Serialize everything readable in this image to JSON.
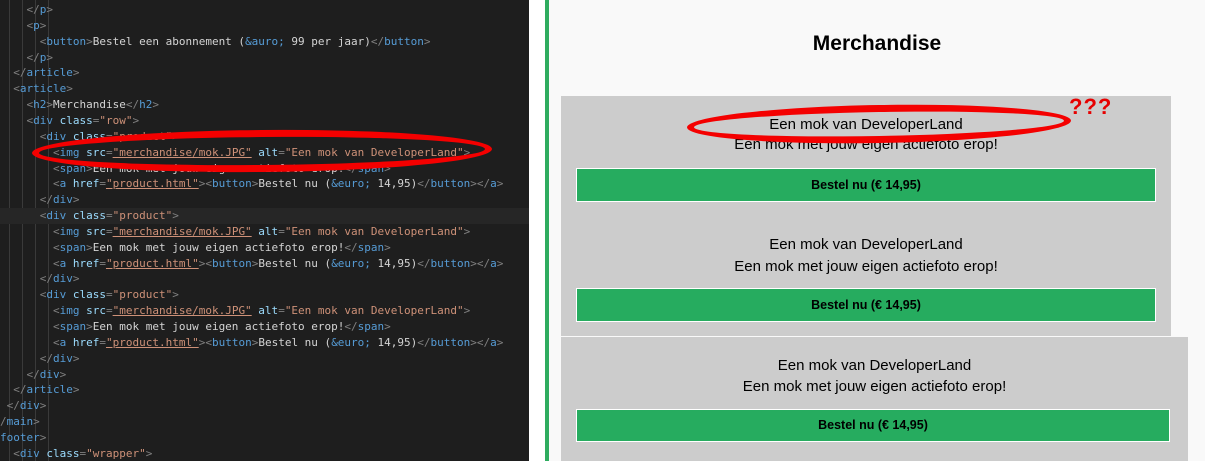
{
  "editor": {
    "lines": [
      [
        {
          "c": "t-punct",
          "t": "    </"
        },
        {
          "c": "t-tag",
          "t": "p"
        },
        {
          "c": "t-punct",
          "t": ">"
        }
      ],
      [
        {
          "c": "t-punct",
          "t": "    <"
        },
        {
          "c": "t-tag",
          "t": "p"
        },
        {
          "c": "t-punct",
          "t": ">"
        }
      ],
      [
        {
          "c": "t-punct",
          "t": "      <"
        },
        {
          "c": "t-tag",
          "t": "button"
        },
        {
          "c": "t-punct",
          "t": ">"
        },
        {
          "c": "t-text",
          "t": "Bestel een abonnement ("
        },
        {
          "c": "t-ent",
          "t": "&auro;"
        },
        {
          "c": "t-text",
          "t": " 99 per jaar)"
        },
        {
          "c": "t-punct",
          "t": "</"
        },
        {
          "c": "t-tag",
          "t": "button"
        },
        {
          "c": "t-punct",
          "t": ">"
        }
      ],
      [
        {
          "c": "t-punct",
          "t": "    </"
        },
        {
          "c": "t-tag",
          "t": "p"
        },
        {
          "c": "t-punct",
          "t": ">"
        }
      ],
      [
        {
          "c": "t-punct",
          "t": "  </"
        },
        {
          "c": "t-tag",
          "t": "article"
        },
        {
          "c": "t-punct",
          "t": ">"
        }
      ],
      [
        {
          "c": "t-punct",
          "t": "  <"
        },
        {
          "c": "t-tag",
          "t": "article"
        },
        {
          "c": "t-punct",
          "t": ">"
        }
      ],
      [
        {
          "c": "t-punct",
          "t": "    <"
        },
        {
          "c": "t-tag",
          "t": "h2"
        },
        {
          "c": "t-punct",
          "t": ">"
        },
        {
          "c": "t-text",
          "t": "Merchandise"
        },
        {
          "c": "t-punct",
          "t": "</"
        },
        {
          "c": "t-tag",
          "t": "h2"
        },
        {
          "c": "t-punct",
          "t": ">"
        }
      ],
      [
        {
          "c": "t-punct",
          "t": "    <"
        },
        {
          "c": "t-tag",
          "t": "div"
        },
        {
          "c": "t-attr",
          "t": " class"
        },
        {
          "c": "t-punct",
          "t": "="
        },
        {
          "c": "t-str",
          "t": "\"row\""
        },
        {
          "c": "t-punct",
          "t": ">"
        }
      ],
      [
        {
          "c": "t-punct",
          "t": "      <"
        },
        {
          "c": "t-tag",
          "t": "div"
        },
        {
          "c": "t-attr",
          "t": " class"
        },
        {
          "c": "t-punct",
          "t": "="
        },
        {
          "c": "t-str",
          "t": "\"product\""
        },
        {
          "c": "t-punct",
          "t": ">"
        }
      ],
      [
        {
          "c": "t-punct",
          "t": "        <"
        },
        {
          "c": "t-tag",
          "t": "img"
        },
        {
          "c": "t-attr",
          "t": " src"
        },
        {
          "c": "t-punct",
          "t": "="
        },
        {
          "c": "t-str u",
          "t": "\"merchandise/mok.JPG\""
        },
        {
          "c": "t-attr",
          "t": " alt"
        },
        {
          "c": "t-punct",
          "t": "="
        },
        {
          "c": "t-str",
          "t": "\"Een mok van DeveloperLand\""
        },
        {
          "c": "t-punct",
          "t": ">"
        }
      ],
      [
        {
          "c": "t-punct",
          "t": "        <"
        },
        {
          "c": "t-tag",
          "t": "span"
        },
        {
          "c": "t-punct",
          "t": ">"
        },
        {
          "c": "t-text",
          "t": "Een mok met jouw eigen actiefoto erop!"
        },
        {
          "c": "t-punct",
          "t": "</"
        },
        {
          "c": "t-tag",
          "t": "span"
        },
        {
          "c": "t-punct",
          "t": ">"
        }
      ],
      [
        {
          "c": "t-punct",
          "t": "        <"
        },
        {
          "c": "t-tag",
          "t": "a"
        },
        {
          "c": "t-attr",
          "t": " href"
        },
        {
          "c": "t-punct",
          "t": "="
        },
        {
          "c": "t-str u",
          "t": "\"product.html\""
        },
        {
          "c": "t-punct",
          "t": "><"
        },
        {
          "c": "t-tag",
          "t": "button"
        },
        {
          "c": "t-punct",
          "t": ">"
        },
        {
          "c": "t-text",
          "t": "Bestel nu ("
        },
        {
          "c": "t-ent",
          "t": "&euro;"
        },
        {
          "c": "t-text",
          "t": " 14,95)"
        },
        {
          "c": "t-punct",
          "t": "</"
        },
        {
          "c": "t-tag",
          "t": "button"
        },
        {
          "c": "t-punct",
          "t": "></"
        },
        {
          "c": "t-tag",
          "t": "a"
        },
        {
          "c": "t-punct",
          "t": ">"
        }
      ],
      [
        {
          "c": "t-punct",
          "t": "      </"
        },
        {
          "c": "t-tag",
          "t": "div"
        },
        {
          "c": "t-punct",
          "t": ">"
        }
      ],
      [
        {
          "c": "t-punct",
          "t": "      <"
        },
        {
          "c": "t-tag",
          "t": "div"
        },
        {
          "c": "t-attr",
          "t": " class"
        },
        {
          "c": "t-punct",
          "t": "="
        },
        {
          "c": "t-str",
          "t": "\"product\""
        },
        {
          "c": "t-punct",
          "t": ">"
        }
      ],
      [
        {
          "c": "t-punct",
          "t": "        <"
        },
        {
          "c": "t-tag",
          "t": "img"
        },
        {
          "c": "t-attr",
          "t": " src"
        },
        {
          "c": "t-punct",
          "t": "="
        },
        {
          "c": "t-str u",
          "t": "\"merchandise/mok.JPG\""
        },
        {
          "c": "t-attr",
          "t": " alt"
        },
        {
          "c": "t-punct",
          "t": "="
        },
        {
          "c": "t-str",
          "t": "\"Een mok van DeveloperLand\""
        },
        {
          "c": "t-punct",
          "t": ">"
        }
      ],
      [
        {
          "c": "t-punct",
          "t": "        <"
        },
        {
          "c": "t-tag",
          "t": "span"
        },
        {
          "c": "t-punct",
          "t": ">"
        },
        {
          "c": "t-text",
          "t": "Een mok met jouw eigen actiefoto erop!"
        },
        {
          "c": "t-punct",
          "t": "</"
        },
        {
          "c": "t-tag",
          "t": "span"
        },
        {
          "c": "t-punct",
          "t": ">"
        }
      ],
      [
        {
          "c": "t-punct",
          "t": "        <"
        },
        {
          "c": "t-tag",
          "t": "a"
        },
        {
          "c": "t-attr",
          "t": " href"
        },
        {
          "c": "t-punct",
          "t": "="
        },
        {
          "c": "t-str u",
          "t": "\"product.html\""
        },
        {
          "c": "t-punct",
          "t": "><"
        },
        {
          "c": "t-tag",
          "t": "button"
        },
        {
          "c": "t-punct",
          "t": ">"
        },
        {
          "c": "t-text",
          "t": "Bestel nu ("
        },
        {
          "c": "t-ent",
          "t": "&euro;"
        },
        {
          "c": "t-text",
          "t": " 14,95)"
        },
        {
          "c": "t-punct",
          "t": "</"
        },
        {
          "c": "t-tag",
          "t": "button"
        },
        {
          "c": "t-punct",
          "t": "></"
        },
        {
          "c": "t-tag",
          "t": "a"
        },
        {
          "c": "t-punct",
          "t": ">"
        }
      ],
      [
        {
          "c": "t-punct",
          "t": "      </"
        },
        {
          "c": "t-tag",
          "t": "div"
        },
        {
          "c": "t-punct",
          "t": ">"
        }
      ],
      [
        {
          "c": "t-punct",
          "t": "      <"
        },
        {
          "c": "t-tag",
          "t": "div"
        },
        {
          "c": "t-attr",
          "t": " class"
        },
        {
          "c": "t-punct",
          "t": "="
        },
        {
          "c": "t-str",
          "t": "\"product\""
        },
        {
          "c": "t-punct",
          "t": ">"
        }
      ],
      [
        {
          "c": "t-punct",
          "t": "        <"
        },
        {
          "c": "t-tag",
          "t": "img"
        },
        {
          "c": "t-attr",
          "t": " src"
        },
        {
          "c": "t-punct",
          "t": "="
        },
        {
          "c": "t-str u",
          "t": "\"merchandise/mok.JPG\""
        },
        {
          "c": "t-attr",
          "t": " alt"
        },
        {
          "c": "t-punct",
          "t": "="
        },
        {
          "c": "t-str",
          "t": "\"Een mok van DeveloperLand\""
        },
        {
          "c": "t-punct",
          "t": ">"
        }
      ],
      [
        {
          "c": "t-punct",
          "t": "        <"
        },
        {
          "c": "t-tag",
          "t": "span"
        },
        {
          "c": "t-punct",
          "t": ">"
        },
        {
          "c": "t-text",
          "t": "Een mok met jouw eigen actiefoto erop!"
        },
        {
          "c": "t-punct",
          "t": "</"
        },
        {
          "c": "t-tag",
          "t": "span"
        },
        {
          "c": "t-punct",
          "t": ">"
        }
      ],
      [
        {
          "c": "t-punct",
          "t": "        <"
        },
        {
          "c": "t-tag",
          "t": "a"
        },
        {
          "c": "t-attr",
          "t": " href"
        },
        {
          "c": "t-punct",
          "t": "="
        },
        {
          "c": "t-str u",
          "t": "\"product.html\""
        },
        {
          "c": "t-punct",
          "t": "><"
        },
        {
          "c": "t-tag",
          "t": "button"
        },
        {
          "c": "t-punct",
          "t": ">"
        },
        {
          "c": "t-text",
          "t": "Bestel nu ("
        },
        {
          "c": "t-ent",
          "t": "&euro;"
        },
        {
          "c": "t-text",
          "t": " 14,95)"
        },
        {
          "c": "t-punct",
          "t": "</"
        },
        {
          "c": "t-tag",
          "t": "button"
        },
        {
          "c": "t-punct",
          "t": "></"
        },
        {
          "c": "t-tag",
          "t": "a"
        },
        {
          "c": "t-punct",
          "t": ">"
        }
      ],
      [
        {
          "c": "t-punct",
          "t": "      </"
        },
        {
          "c": "t-tag",
          "t": "div"
        },
        {
          "c": "t-punct",
          "t": ">"
        }
      ],
      [
        {
          "c": "t-punct",
          "t": "    </"
        },
        {
          "c": "t-tag",
          "t": "div"
        },
        {
          "c": "t-punct",
          "t": ">"
        }
      ],
      [
        {
          "c": "t-punct",
          "t": "  </"
        },
        {
          "c": "t-tag",
          "t": "article"
        },
        {
          "c": "t-punct",
          "t": ">"
        }
      ],
      [
        {
          "c": "t-punct",
          "t": " </"
        },
        {
          "c": "t-tag",
          "t": "div"
        },
        {
          "c": "t-punct",
          "t": ">"
        }
      ],
      [
        {
          "c": "t-punct",
          "t": "/"
        },
        {
          "c": "t-tag",
          "t": "main"
        },
        {
          "c": "t-punct",
          "t": ">"
        }
      ],
      [
        {
          "c": "t-tag",
          "t": "footer"
        },
        {
          "c": "t-punct",
          "t": ">"
        }
      ],
      [
        {
          "c": "t-punct",
          "t": "  <"
        },
        {
          "c": "t-tag",
          "t": "div"
        },
        {
          "c": "t-attr",
          "t": " class"
        },
        {
          "c": "t-punct",
          "t": "="
        },
        {
          "c": "t-str",
          "t": "\"wrapper\""
        },
        {
          "c": "t-punct",
          "t": ">"
        }
      ]
    ]
  },
  "preview": {
    "heading": "Merchandise",
    "annotation": "???",
    "products": [
      {
        "title": "Een mok van DeveloperLand",
        "description": "Een mok met jouw eigen actiefoto erop!",
        "button": "Bestel nu (€ 14,95)"
      },
      {
        "title": "Een mok van DeveloperLand",
        "description": "Een mok met jouw eigen actiefoto erop!",
        "button": "Bestel nu (€ 14,95)"
      },
      {
        "title": "Een mok van DeveloperLand",
        "description": "Een mok met jouw eigen actiefoto erop!",
        "button": "Bestel nu (€ 14,95)"
      }
    ]
  },
  "colors": {
    "accent_green": "#26ac5f",
    "annotation_red": "#f40000",
    "card_gray": "#cccccc",
    "editor_bg": "#1e1e1e"
  }
}
